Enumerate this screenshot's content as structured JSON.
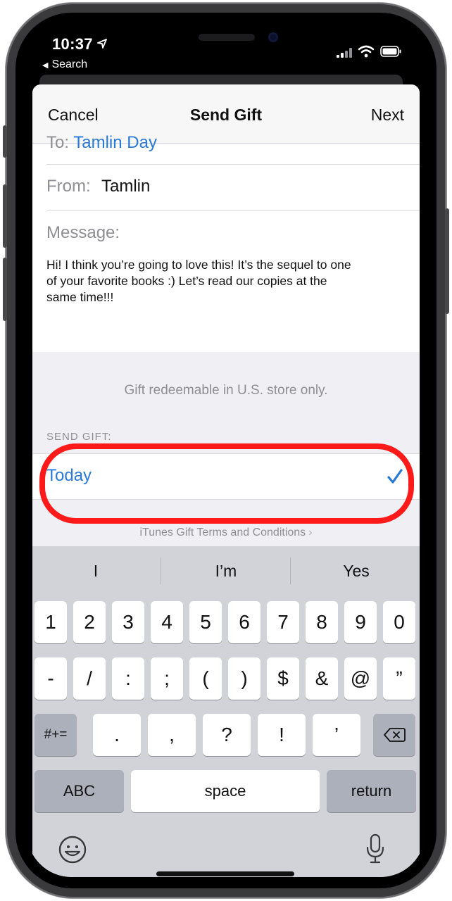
{
  "status_bar": {
    "time": "10:37",
    "back_app": "Search"
  },
  "nav": {
    "cancel": "Cancel",
    "title": "Send Gift",
    "next": "Next"
  },
  "form": {
    "to_label": "To:",
    "to_value": "Tamlin Day",
    "from_label": "From:",
    "from_value": "Tamlin",
    "message_label": "Message:",
    "message_line1": "Hi! I think you’re going to love this! It’s the sequel to one",
    "message_line2": "of your favorite books :) Let’s read our copies at the",
    "message_line3": "same time!!!"
  },
  "gift_note": "Gift redeemable in U.S. store only.",
  "send_section": {
    "header": "SEND GIFT:",
    "option": "Today",
    "selected": true
  },
  "terms": "iTunes Gift Terms and Conditions",
  "keyboard": {
    "predictions": [
      "I",
      "I’m",
      "Yes"
    ],
    "row1": [
      "1",
      "2",
      "3",
      "4",
      "5",
      "6",
      "7",
      "8",
      "9",
      "0"
    ],
    "row2": [
      "-",
      "/",
      ":",
      ";",
      "(",
      ")",
      "$",
      "&",
      "@",
      "”"
    ],
    "row3_left": "#+=",
    "row3": [
      ".",
      ",",
      "?",
      "!",
      "’"
    ],
    "abc": "ABC",
    "space": "space",
    "return": "return"
  },
  "colors": {
    "accent": "#2979d8",
    "highlight": "#ff1a1a"
  },
  "icons": [
    "location-arrow-icon",
    "signal-icon",
    "wifi-icon",
    "battery-icon",
    "checkmark-icon",
    "chevron-right-icon",
    "backspace-icon",
    "emoji-icon",
    "microphone-icon"
  ]
}
